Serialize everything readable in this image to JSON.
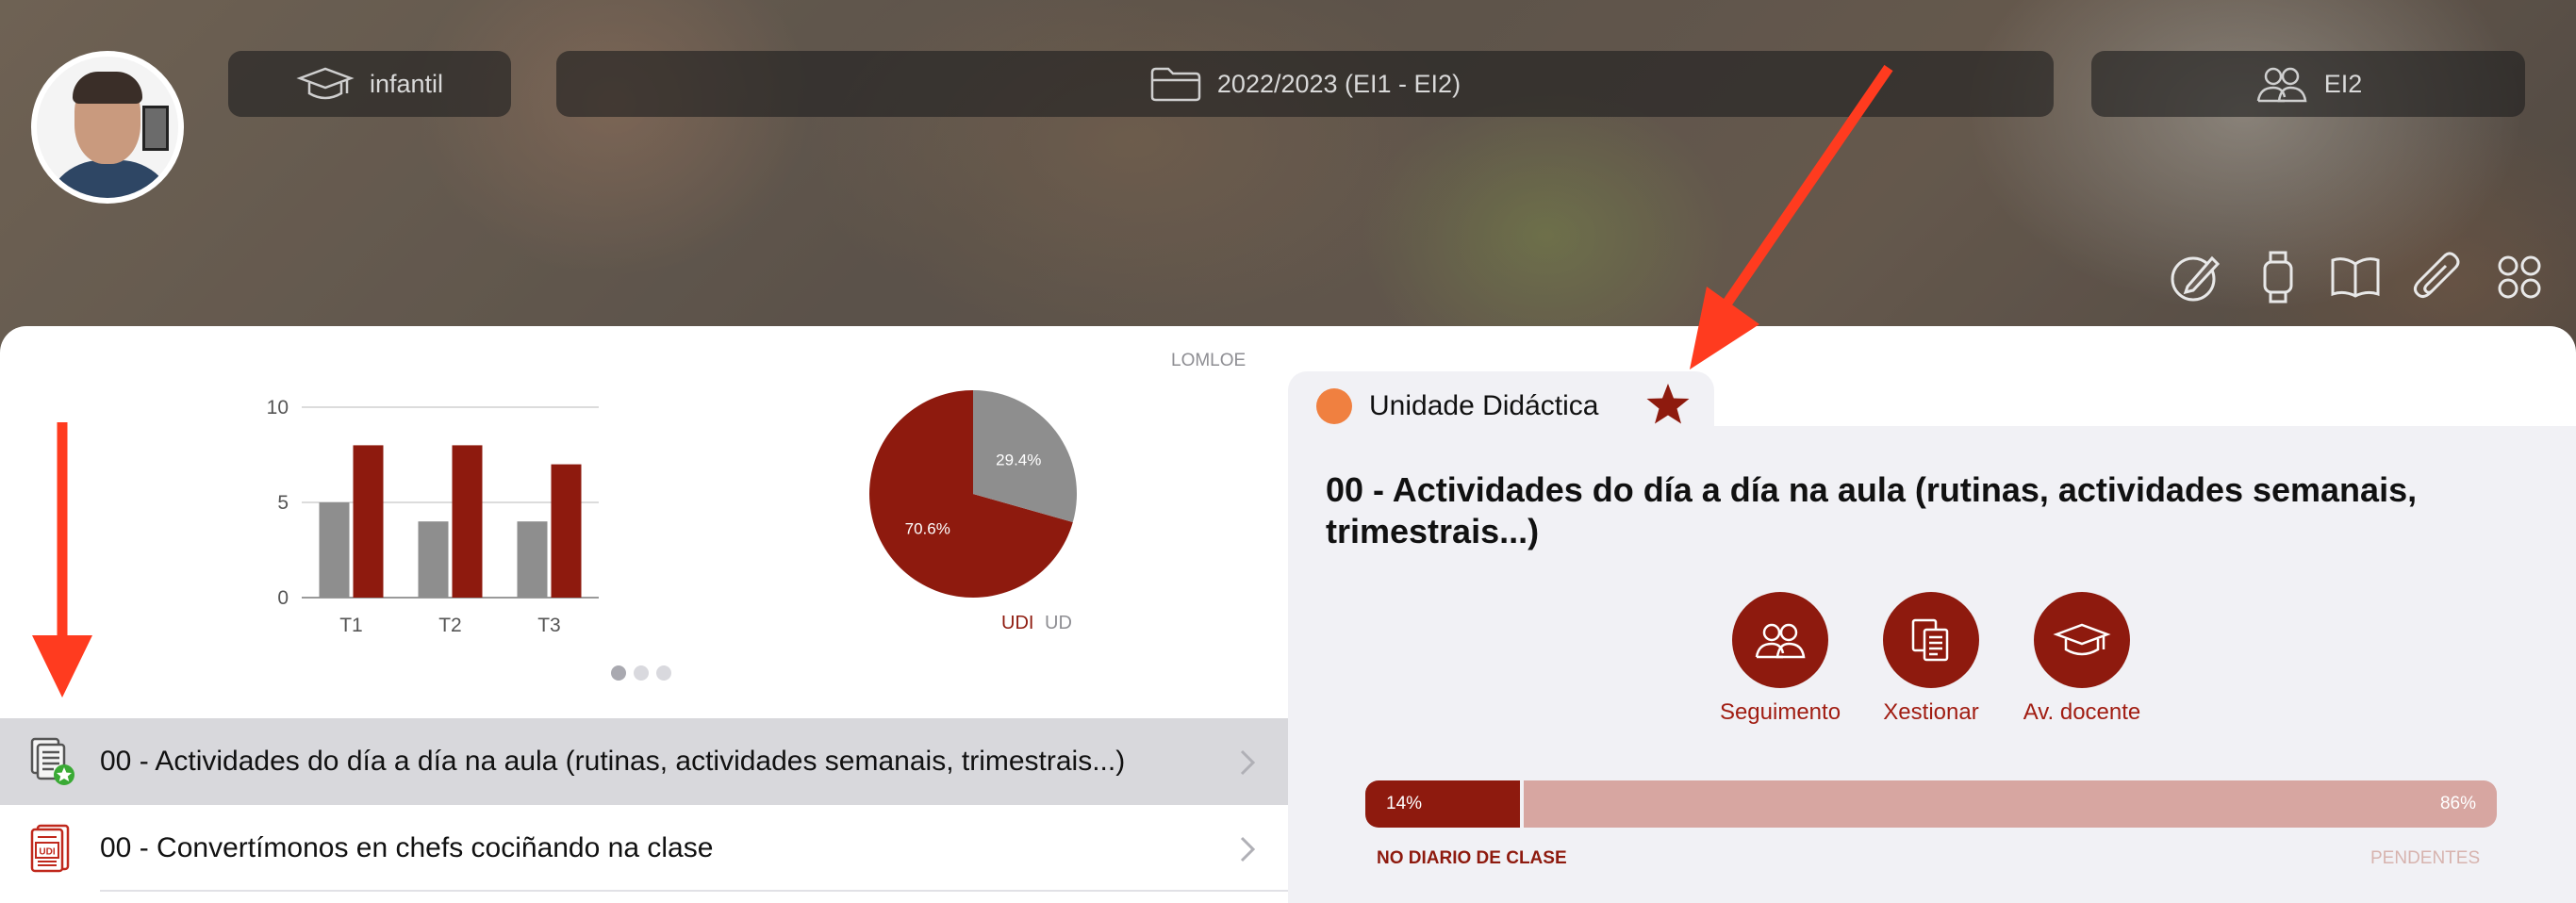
{
  "header": {
    "level_label": "infantil",
    "year_label": "2022/2023 (EI1 - EI2)",
    "group_label": "EI2",
    "tools": [
      "edit-icon",
      "watch-icon",
      "book-icon",
      "paperclip-icon",
      "grid-icon"
    ]
  },
  "overview": {
    "badge": "LOMLOE",
    "legend_udi": "UDI",
    "legend_ud": "UD"
  },
  "chart_data": [
    {
      "type": "bar",
      "categories": [
        "T1",
        "T2",
        "T3"
      ],
      "series": [
        {
          "values": [
            5,
            4,
            4
          ],
          "color": "#8e8e8e"
        },
        {
          "values": [
            8,
            8,
            7
          ],
          "color": "#8e1a0e"
        }
      ],
      "yticks": [
        0,
        5,
        10
      ],
      "ylim": [
        0,
        10
      ],
      "grid": true
    },
    {
      "type": "pie",
      "slices": [
        {
          "label": "UDI",
          "value": 70.6,
          "text": "70.6%",
          "color": "#8e1a0e"
        },
        {
          "label": "UD",
          "value": 29.4,
          "text": "29.4%",
          "color": "#8e8e8e"
        }
      ]
    }
  ],
  "carousel": {
    "pages": 3,
    "active": 0
  },
  "units": [
    {
      "title": "00 - Actividades do día a día na aula (rutinas, actividades semanais, trimestrais...)",
      "icon": "document-star-icon",
      "selected": true
    },
    {
      "title": "00 - Convertímonos en chefs cociñando na clase",
      "icon": "udi-document-icon",
      "selected": false
    }
  ],
  "detail": {
    "tab_label": "Unidade Didáctica",
    "tab_dot_color": "#f08040",
    "favorite": true,
    "title": "00 - Actividades do día a día na aula (rutinas, actividades semanais, trimestrais...)",
    "actions": {
      "seguimento": "Seguimento",
      "xestionar": "Xestionar",
      "av_docente": "Av. docente"
    },
    "progress": {
      "done_fraction": 0.14,
      "done_text": "14%",
      "rest_text": "86%",
      "done_label": "NO DIARIO DE CLASE",
      "rest_label": "PENDENTES"
    }
  },
  "colors": {
    "accent": "#8e1a0e",
    "accent_light": "#d7a6a1",
    "annotation": "#ff3b1f"
  }
}
